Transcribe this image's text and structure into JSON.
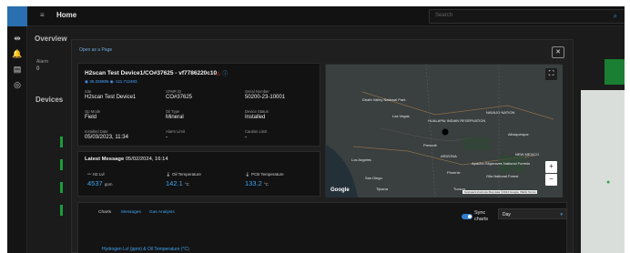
{
  "topbar": {
    "title": "Home",
    "search_placeholder": "Search"
  },
  "background": {
    "overview": "Overview",
    "alarm_label": "Alarm",
    "alarm_value": "0",
    "devices": "Devices"
  },
  "modal": {
    "open_link": "Open as a Page",
    "device": {
      "title": "H2scan Test Device1/CO#37625 - vf7786220c10",
      "lat": "35.326886",
      "lon": "-111.712483"
    },
    "fields": [
      {
        "label": "Site",
        "value": "H2scan Test Device1"
      },
      {
        "label": "XFMR ID",
        "value": "CO#37625"
      },
      {
        "label": "Serial Number",
        "value": "50200-23-10001"
      },
      {
        "label": "Op Mode",
        "value": "Field"
      },
      {
        "label": "Oil Type",
        "value": "Mineral"
      },
      {
        "label": "Device Status",
        "value": "Installed"
      },
      {
        "label": "Installed Date",
        "value": "05/03/2023, 11:34"
      },
      {
        "label": "Alarm Limit",
        "value": "-"
      },
      {
        "label": "Caution Limit",
        "value": "-"
      }
    ],
    "latest": {
      "title": "Latest Message",
      "date": "05/02/2024, 16:14",
      "metrics": [
        {
          "label": "H2 Lvl",
          "value": "4537",
          "unit": "ppm"
        },
        {
          "label": "Oil Temperature",
          "value": "142.1",
          "unit": "°C"
        },
        {
          "label": "PCB Temperature",
          "value": "133.2",
          "unit": "°C"
        }
      ]
    },
    "tabs": [
      "Charts",
      "Messages",
      "Gas Analysis"
    ],
    "sync_label": "Sync charts",
    "range_select": "Day",
    "chart_title": "Hydrogen Lvl (ppm) & Oil Temperature (°C)"
  },
  "map": {
    "labels": [
      "Death Valley National Park",
      "Las Vegas",
      "NAVAJO NATION",
      "HUALAPAI INDIAN RESERVATION",
      "Los Angeles",
      "ARIZONA",
      "San Diego",
      "Tijuana",
      "Phoenix",
      "Tucson",
      "Albuquerque",
      "NEW MEXICO",
      "Apache-Sitgreaves National Forests",
      "Gila National Forest",
      "Prescott"
    ],
    "attribution": "Keyboard shortcuts  Map data ©2024 Google, INEGI  Terms"
  },
  "colors": {
    "accent": "#3fa4f0",
    "status_green": "#1d9c3b"
  }
}
